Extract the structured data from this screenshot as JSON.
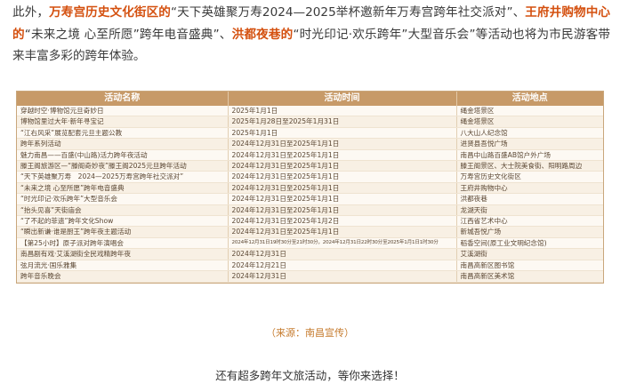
{
  "intro": {
    "p1": "此外，",
    "hl1": "万寿宫历史文化街区的",
    "p2": "“天下英雄聚万寿2024—2025举杯邀新年万寿宫跨年社交派对”、",
    "hl2": "王府井购物中心的",
    "p3": "“未来之境 心至所愿”跨年电音盛典”、",
    "hl3": "洪都夜巷的",
    "p4": "“时光印记·欢乐跨年”大型音乐会”等活动也将为市民游客带来丰富多彩的跨年体验。"
  },
  "table": {
    "headers": [
      "活动名称",
      "活动时间",
      "活动地点"
    ],
    "rows": [
      [
        "穿越时空·博物馆元旦奇妙日",
        "2025年1月1日",
        "绳金塔景区"
      ],
      [
        "博物馆里过大年·新年寻宝记",
        "2025年1月28日至2025年1月31日",
        "绳金塔景区"
      ],
      [
        "“江右风采”展览配套元旦主题公教",
        "2025年1月1日",
        "八大山人纪念馆"
      ],
      [
        "跨年系列活动",
        "2024年12月31日至2025年1月1日",
        "进贤县吾悦广场"
      ],
      [
        "魅力南昌——百盛(中山路)活力跨年夜活动",
        "2024年12月31日至2025年1月1日",
        "南昌中山路百盛AB馆户外广场"
      ],
      [
        "滕王阁旅游区—“滕阁奇妙夜”滕王阁2025元旦跨年活动",
        "2024年12月31日至2025年1月1日",
        "滕王阁景区、大士院美食街、阳明路周边"
      ],
      [
        "“天下英雄聚万寿　2024—2025万寿宫跨年社交派对”",
        "2024年12月31日至2025年1月1日",
        "万寿宫历史文化街区"
      ],
      [
        "“未来之境 心至所愿”跨年电音盛典",
        "2024年12月31日至2025年1月1日",
        "王府井购物中心"
      ],
      [
        "“时光印记·欢乐跨年”大型音乐会",
        "2024年12月31日至2025年1月1日",
        "洪都夜巷"
      ],
      [
        "“抬头见喜”天街庙会",
        "2024年12月31日至2025年1月1日",
        "龙湖天街"
      ],
      [
        "“了不起的菲遗”跨年文化Show",
        "2024年12月31日至2025年1月2日",
        "江西省艺术中心"
      ],
      [
        "“瞬出新谦·谁是厨王”跨年夜主题活动",
        "2024年12月31日至2025年1月1日",
        "新城吾悦广场"
      ],
      [
        "【第25小时】原子派对跨年演唱会",
        "2024年12月31日19时30分至21时30分，2024年12月31日22时30分至2025年1月1日1时30分",
        "稻香空间(原工业文明纪念馆)"
      ],
      [
        "南昌剧有戏·艾溪湖街全民戏精跨年夜",
        "2024年12月31日",
        "艾溪湖街"
      ],
      [
        "弦月流光·国乐雅集",
        "2024年12月21日",
        "南昌高新区图书馆"
      ],
      [
        "跨年音乐晚会",
        "2024年12月31日",
        "南昌高新区美术馆"
      ]
    ]
  },
  "source": "（来源：南昌宣传）",
  "footer": "还有超多跨年文旅活动，等你来选择！"
}
